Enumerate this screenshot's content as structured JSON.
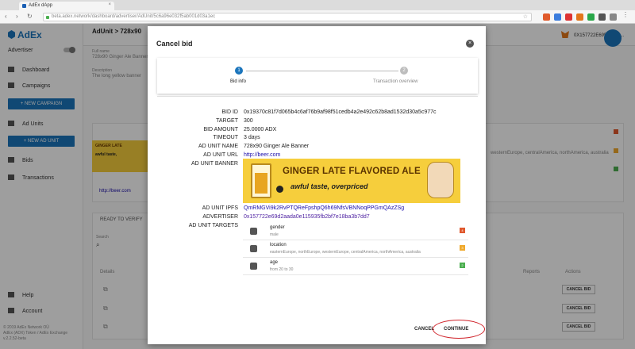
{
  "browser": {
    "tab_title": "AdEx dApp",
    "tab_close": "×",
    "url": "beta.adex.network/dashboard/advertiser/AdUnit/5c6a96e032f5ab001d03a1ec",
    "back": "‹",
    "forward": "›",
    "reload": "↻",
    "star": "☆"
  },
  "app": {
    "logo": "AdEx",
    "mode_label": "Advertiser",
    "nav": [
      "Dashboard",
      "Campaigns",
      "Ad Units",
      "Bids",
      "Transactions"
    ],
    "new_campaign": "+ NEW CAMPAIGN",
    "new_ad_unit": "+ NEW AD UNIT",
    "help": "Help",
    "account": "Account",
    "footer": [
      "© 2019 AdEx Network OÜ",
      "AdEx (ADX) Token / AdEx Exchange",
      "v.2.2.52-beta"
    ],
    "wallet": "0X157722E69D2AAD...",
    "breadcrumb": "AdUnit > 728x90",
    "full_name_label": "Full name",
    "full_name": "728x90 Ginger Ale Banner",
    "description_label": "Description",
    "description": "The long yellow banner",
    "bg_url": "http://beer.com",
    "ready_to_verify": "READY TO VERIFY",
    "search_label": "Search",
    "col_details": "Details",
    "col_reports": "Reports",
    "col_actions": "Actions",
    "bg_targets": "westernEurope, centralAmerica, northAmerica, australia",
    "cancel_bid_button": "CANCEL BID",
    "bg_banner_line1": "GINGER LATE",
    "bg_banner_line2": "awful taste,"
  },
  "modal": {
    "title": "Cancel bid",
    "close": "×",
    "steps": [
      {
        "num": "1",
        "label": "Bid info",
        "active": true
      },
      {
        "num": "2",
        "label": "Transaction overview",
        "active": false
      }
    ],
    "fields": [
      {
        "label": "BID ID",
        "value": "0x19370c81f7d065b4c6af76b9af98f51cedb4a2e492c62b8ad1532d30a5c977c"
      },
      {
        "label": "TARGET",
        "value": "300"
      },
      {
        "label": "BID AMOUNT",
        "value": "25.0000 ADX"
      },
      {
        "label": "TIMEOUT",
        "value": "3 days"
      },
      {
        "label": "AD UNIT NAME",
        "value": "728x90 Ginger Ale Banner"
      },
      {
        "label": "AD UNIT URL",
        "value": "http://beer.com"
      },
      {
        "label": "AD UNIT BANNER",
        "value": ""
      },
      {
        "label": "AD UNIT IPFS",
        "value": "QmRMGVi9k2RvPTQReFpshpQ6h69NfsVBNNoqPPGmQAzZSg"
      },
      {
        "label": "ADVERTISER",
        "value": "0x157722e69d2aada0e115935fb2bf7e18ba3b7dd7"
      },
      {
        "label": "AD UNIT TARGETS",
        "value": ""
      }
    ],
    "banner": {
      "line1": "GINGER LATE FLAVORED ALE",
      "line2": "awful taste, overpriced"
    },
    "targets": [
      {
        "key": "gender",
        "value": "male",
        "weight": "4",
        "color": "#e0582d",
        "icon": "gender-icon"
      },
      {
        "key": "location",
        "value": "easternEurope, northEurope, westernEurope, centralAmerica, northAmerica, australia",
        "weight": "3",
        "color": "#f0a92c",
        "icon": "location-pin-icon"
      },
      {
        "key": "age",
        "value": "from 20 to 30",
        "weight": "2",
        "color": "#4caf50",
        "icon": "eye-icon"
      }
    ],
    "cancel": "CANCEL",
    "continue": "CONTINUE"
  },
  "colors": {
    "accent": "#1b75bc",
    "highlight_circle": "#d0232a",
    "banner_yellow": "#f6ce3c"
  }
}
